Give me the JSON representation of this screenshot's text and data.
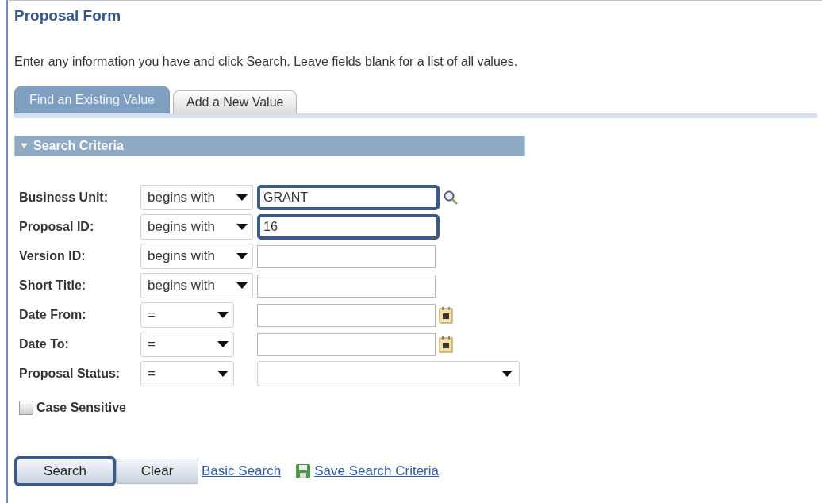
{
  "title": "Proposal Form",
  "instructions": "Enter any information you have and click Search. Leave fields blank for a list of all values.",
  "tabs": [
    {
      "label": "Find an Existing Value",
      "selected": true
    },
    {
      "label": "Add a New Value",
      "selected": false
    }
  ],
  "section": {
    "title": "Search Criteria",
    "expanded": true
  },
  "fields": [
    {
      "label": "Business Unit:",
      "operator": "begins with",
      "kind": "lookup",
      "value": "GRANT",
      "highlighted": true
    },
    {
      "label": "Proposal ID:",
      "operator": "begins with",
      "kind": "text",
      "value": "16",
      "highlighted": true
    },
    {
      "label": "Version ID:",
      "operator": "begins with",
      "kind": "text",
      "highlighted": false
    },
    {
      "label": "Short Title:",
      "operator": "begins with",
      "kind": "text",
      "highlighted": false
    },
    {
      "label": "Date From:",
      "operator": "=",
      "kind": "date",
      "highlighted": false
    },
    {
      "label": "Date To:",
      "operator": "=",
      "kind": "date",
      "highlighted": false
    },
    {
      "label": "Proposal Status:",
      "operator": "=",
      "kind": "select",
      "highlighted": false
    }
  ],
  "case_sensitive": {
    "label": "Case Sensitive",
    "checked": false
  },
  "buttons": [
    {
      "label": "Search",
      "highlighted": true
    },
    {
      "label": "Clear",
      "highlighted": false
    }
  ],
  "links": [
    {
      "label": "Basic Search",
      "kind": "plain"
    },
    {
      "label": "Save Search Criteria",
      "kind": "save"
    }
  ]
}
